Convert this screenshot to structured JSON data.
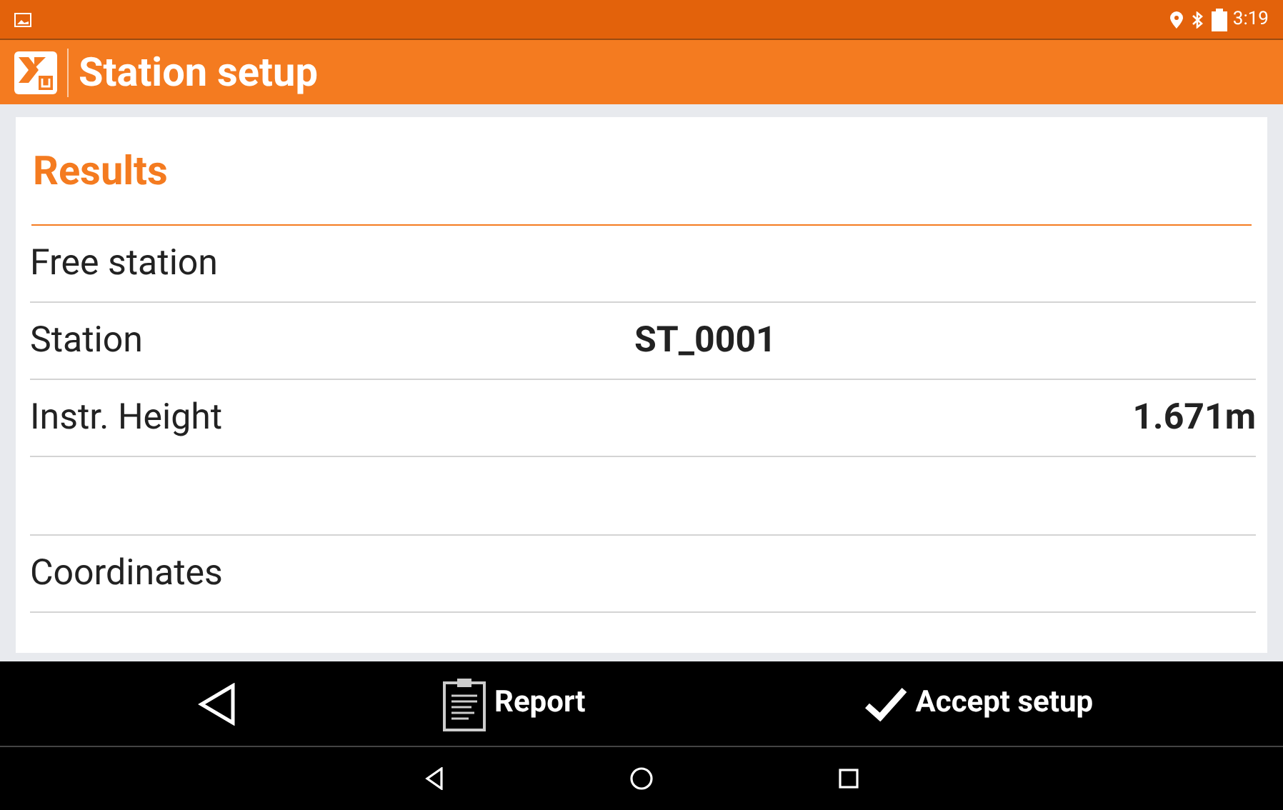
{
  "status_bar": {
    "time": "3:19"
  },
  "app_bar": {
    "title": "Station setup"
  },
  "section": {
    "title": "Results"
  },
  "rows": [
    {
      "label": "Free station"
    },
    {
      "label": "Station",
      "value": "ST_0001",
      "kind": "centered"
    },
    {
      "label": "Instr. Height",
      "value": "1.671m",
      "kind": "trailing"
    },
    {
      "kind": "spacer"
    },
    {
      "label": "Coordinates"
    }
  ],
  "actions": [
    {
      "kind": "back"
    },
    {
      "kind": "report",
      "label": "Report"
    },
    {
      "kind": "accept",
      "label": "Accept setup"
    }
  ]
}
